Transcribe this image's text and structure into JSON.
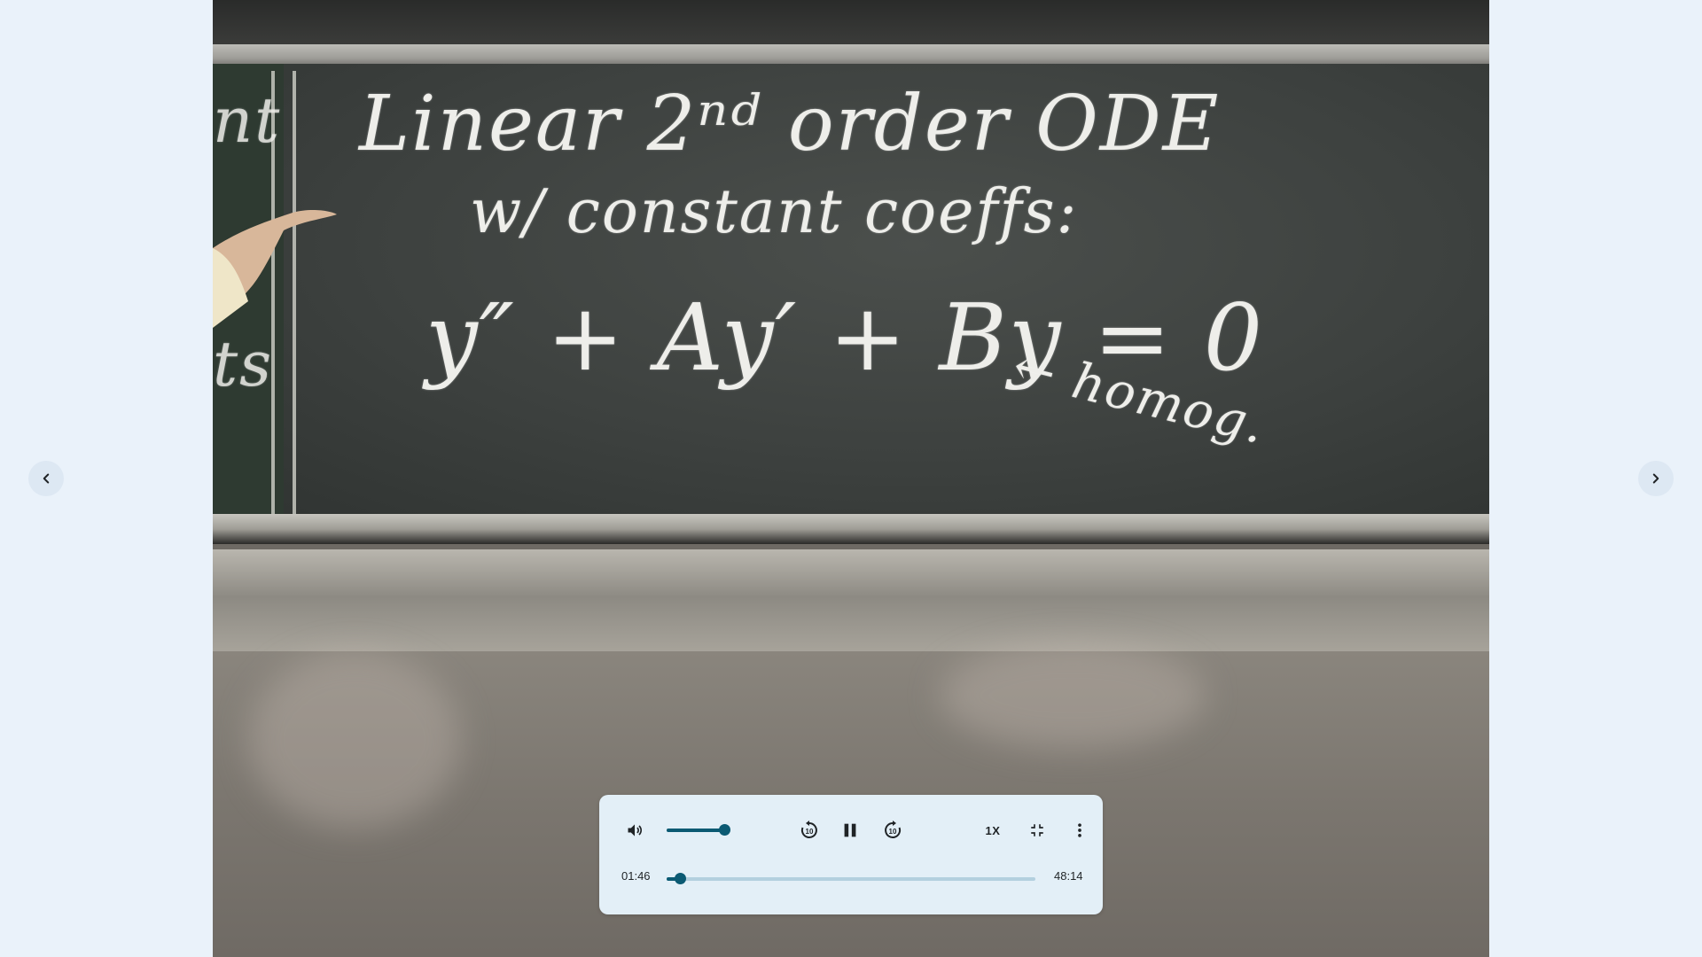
{
  "video": {
    "chalk_lines": {
      "title": "Linear 2ⁿᵈ order ODE",
      "subtitle": "w/ constant coeffs:",
      "equation": "y″ + Ay′ + By = 0",
      "note": "← homog.",
      "left_fragment_1": "nt",
      "left_fragment_2": "ts"
    }
  },
  "navigation": {
    "prev_icon": "chevron-left-icon",
    "next_icon": "chevron-right-icon"
  },
  "player": {
    "volume_icon": "volume-icon",
    "volume_level": 0.9,
    "rewind_icon": "replay-10-icon",
    "pause_icon": "pause-icon",
    "forward_icon": "forward-10-icon",
    "speed_label": "1X",
    "exit_fullscreen_icon": "exit-fullscreen-icon",
    "more_icon": "more-vert-icon",
    "current_time": "01:46",
    "total_time": "48:14",
    "progress": 0.037,
    "accent_color": "#0b5a73"
  }
}
